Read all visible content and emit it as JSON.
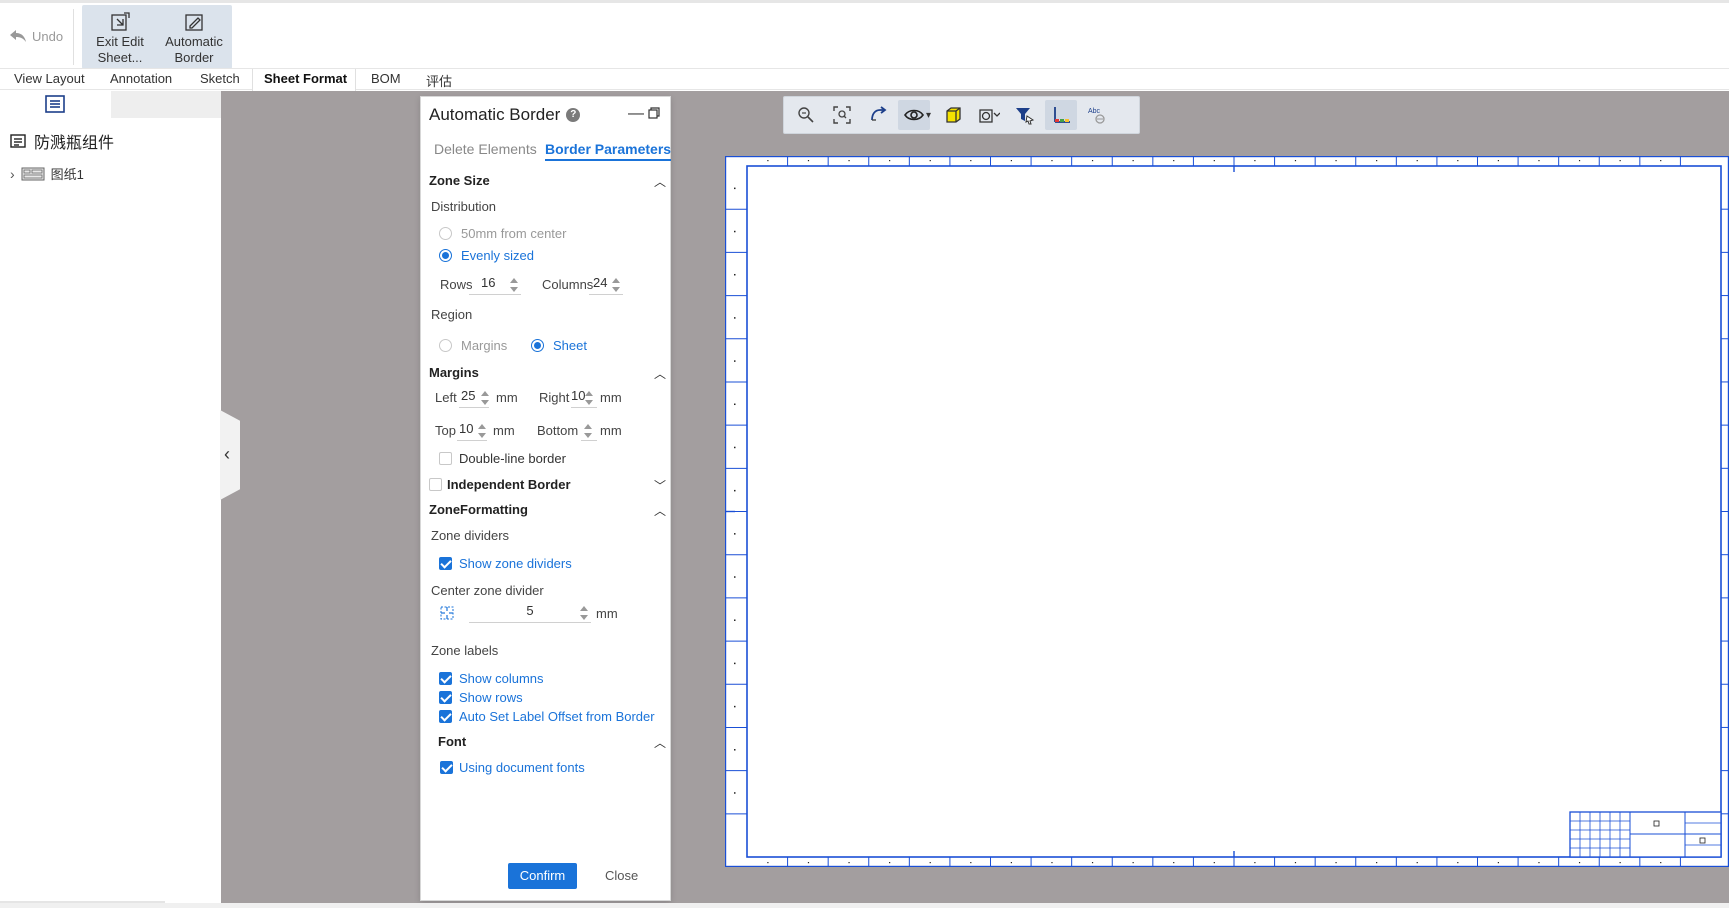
{
  "ribbon": {
    "undo_label": "Undo",
    "exit_edit_label_1": "Exit Edit",
    "exit_edit_label_2": "Sheet...",
    "auto_border_label_1": "Automatic",
    "auto_border_label_2": "Border"
  },
  "tabs": [
    {
      "label": "View Layout"
    },
    {
      "label": "Annotation"
    },
    {
      "label": "Sketch"
    },
    {
      "label": "Sheet Format",
      "active": true
    },
    {
      "label": "BOM"
    },
    {
      "label": "评估"
    }
  ],
  "tree": {
    "root_label": "防溅瓶组件",
    "child_label": "图纸1"
  },
  "dialog": {
    "title": "Automatic Border",
    "help": "?",
    "tabs": {
      "delete_elements": "Delete Elements",
      "border_parameters": "Border Parameters"
    },
    "zone_size": {
      "header": "Zone Size",
      "distribution_label": "Distribution",
      "option_50mm": "50mm from center",
      "option_even": "Evenly sized",
      "rows_label": "Rows",
      "rows_value": "16",
      "columns_label": "Columns",
      "columns_value": "24",
      "region_label": "Region",
      "region_margins": "Margins",
      "region_sheet": "Sheet"
    },
    "margins": {
      "header": "Margins",
      "left_label": "Left",
      "left_value": "25",
      "right_label": "Right",
      "right_value": "10",
      "top_label": "Top",
      "top_value": "10",
      "bottom_label": "Bottom",
      "bottom_value": "",
      "unit": "mm",
      "double_line": "Double-line border"
    },
    "independent_border": {
      "label": "Independent Border"
    },
    "zone_formatting": {
      "header": "ZoneFormatting",
      "zone_dividers_label": "Zone dividers",
      "show_zone_dividers": "Show zone dividers",
      "center_divider_label": "Center zone divider",
      "center_divider_value": "5",
      "unit": "mm",
      "zone_labels_label": "Zone labels",
      "show_columns": "Show columns",
      "show_rows": "Show rows",
      "auto_offset": "Auto Set Label Offset from Border"
    },
    "font": {
      "header": "Font",
      "using_doc_fonts": "Using document fonts"
    },
    "confirm_label": "Confirm",
    "close_label": "Close"
  },
  "colors": {
    "accent": "#1a73d9",
    "canvas_bg": "#a39e9f",
    "border_blue": "#1a4fd6"
  },
  "view_toolbar_icons": [
    "zoom-icon",
    "zoom-fit-icon",
    "redo-view-icon",
    "eye-icon",
    "cube-icon",
    "display-style-icon",
    "filter-icon",
    "axes-icon",
    "text-icon"
  ]
}
